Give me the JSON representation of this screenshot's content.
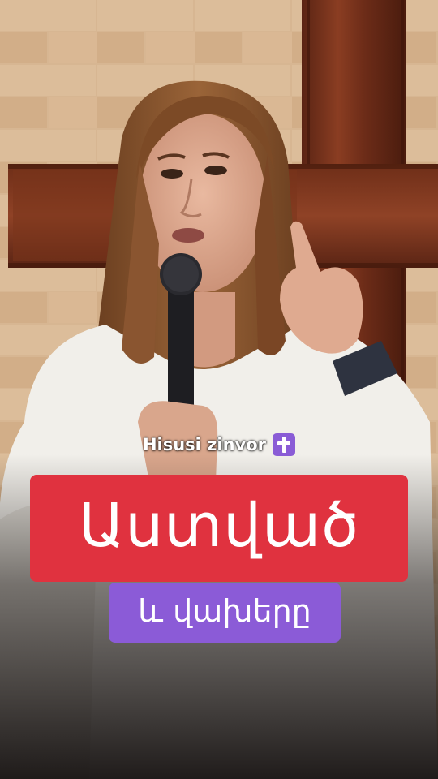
{
  "video": {
    "watermark_text": "Hisusi zinvor",
    "watermark_emoji": "latin-cross-emoji",
    "headline": "Աստված",
    "subheadline": "և վախերը",
    "colors": {
      "headline_bg": "#e0323f",
      "subheadline_bg": "#8b5bd7",
      "emoji_bg": "#8a5cd6",
      "text": "#ffffff"
    }
  }
}
